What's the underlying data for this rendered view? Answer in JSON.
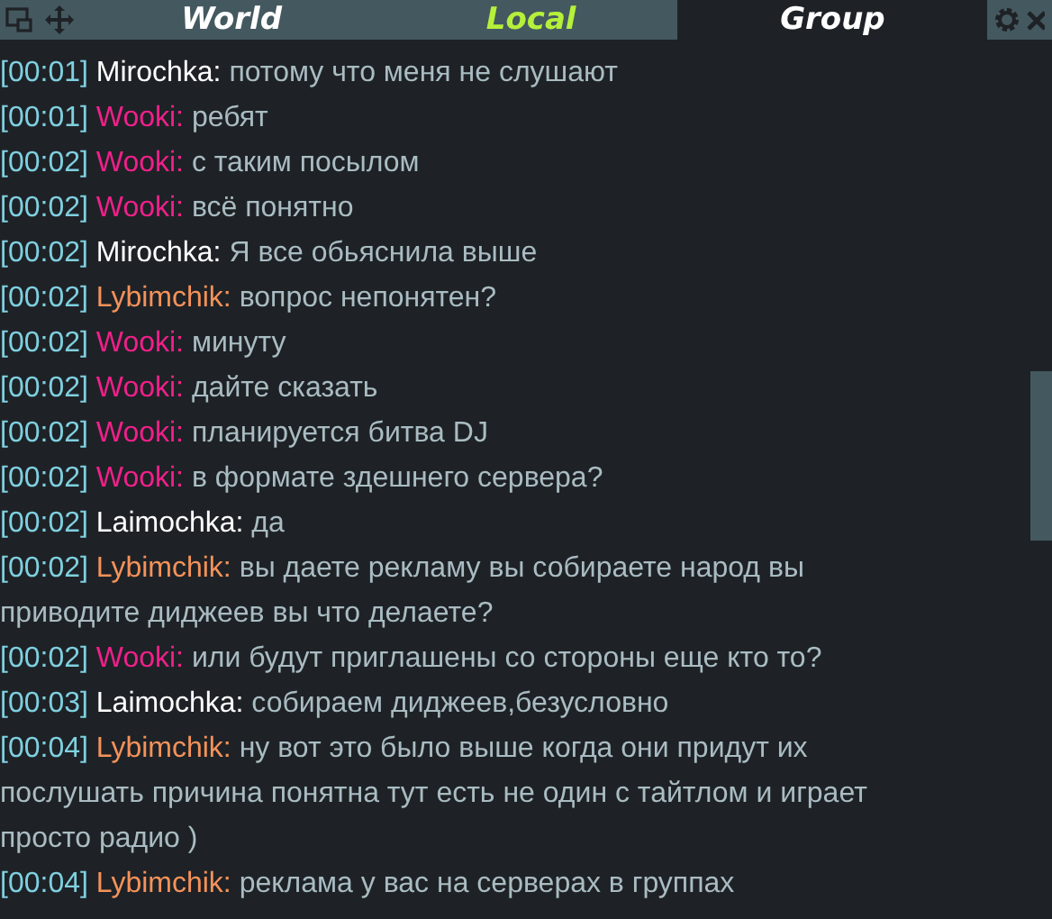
{
  "tabs": [
    {
      "label": "World",
      "selected": false,
      "unread": false
    },
    {
      "label": "Local",
      "selected": false,
      "unread": true
    },
    {
      "label": "Group",
      "selected": true,
      "unread": false
    }
  ],
  "messages": [
    {
      "time": "[00:01]",
      "name": "Mirochka:",
      "color": "#ffffff",
      "text": "потому что меня не слушают"
    },
    {
      "time": "[00:01]",
      "name": "Wooki:",
      "color": "#f0208a",
      "text": "ребят"
    },
    {
      "time": "[00:02]",
      "name": "Wooki:",
      "color": "#f0208a",
      "text": "с таким посылом"
    },
    {
      "time": "[00:02]",
      "name": "Wooki:",
      "color": "#f0208a",
      "text": "всё понятно"
    },
    {
      "time": "[00:02]",
      "name": "Mirochka:",
      "color": "#ffffff",
      "text": "Я все обьяснила выше"
    },
    {
      "time": "[00:02]",
      "name": "Lybimchik:",
      "color": "#f5925a",
      "text": "вопрос непонятен?"
    },
    {
      "time": "[00:02]",
      "name": "Wooki:",
      "color": "#f0208a",
      "text": "минуту"
    },
    {
      "time": "[00:02]",
      "name": "Wooki:",
      "color": "#f0208a",
      "text": "дайте сказать"
    },
    {
      "time": "[00:02]",
      "name": "Wooki:",
      "color": "#f0208a",
      "text": "планируется битва DJ"
    },
    {
      "time": "[00:02]",
      "name": "Wooki:",
      "color": "#f0208a",
      "text": "в формате здешнего сервера?"
    },
    {
      "time": "[00:02]",
      "name": "Laimochka:",
      "color": "#ffffff",
      "text": "да"
    },
    {
      "time": "[00:02]",
      "name": "Lybimchik:",
      "color": "#f5925a",
      "text": "вы даете рекламу вы собираете народ вы приводите диджеев вы что делаете?"
    },
    {
      "time": "[00:02]",
      "name": "Wooki:",
      "color": "#f0208a",
      "text": "или будут приглашены со стороны еще кто то?"
    },
    {
      "time": "[00:03]",
      "name": "Laimochka:",
      "color": "#ffffff",
      "text": "собираем диджеев,безусловно"
    },
    {
      "time": "[00:04]",
      "name": "Lybimchik:",
      "color": "#f5925a",
      "text": "ну вот это было выше когда они придут их послушать причина понятна тут есть не один с тайтлом и играет просто радио )"
    },
    {
      "time": "[00:04]",
      "name": "Lybimchik:",
      "color": "#f5925a",
      "text": "реклама у вас на серверах в группах"
    }
  ]
}
